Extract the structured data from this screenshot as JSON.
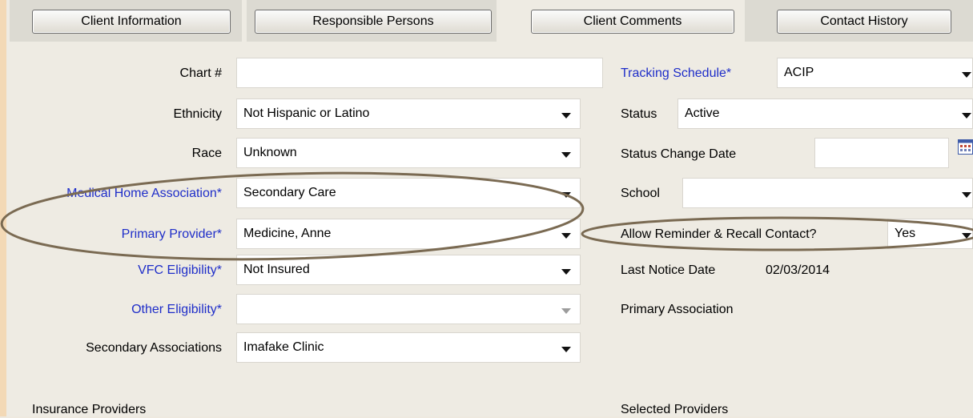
{
  "tabs": {
    "client_information": "Client Information",
    "responsible_persons": "Responsible Persons",
    "client_comments": "Client Comments",
    "contact_history": "Contact History"
  },
  "left": {
    "chart": {
      "label": "Chart #",
      "value": ""
    },
    "ethnicity": {
      "label": "Ethnicity",
      "value": "Not Hispanic or Latino"
    },
    "race": {
      "label": "Race",
      "value": "Unknown"
    },
    "medical_home": {
      "label": "Medical Home Association*",
      "value": "Secondary Care"
    },
    "primary_provider": {
      "label": "Primary Provider*",
      "value": "Medicine, Anne"
    },
    "vfc": {
      "label": "VFC Eligibility*",
      "value": "Not Insured"
    },
    "other_eligibility": {
      "label": "Other Eligibility*",
      "value": ""
    },
    "secondary_assoc": {
      "label": "Secondary Associations",
      "value": "Imafake Clinic"
    }
  },
  "right": {
    "tracking": {
      "label": "Tracking Schedule*",
      "value": "ACIP"
    },
    "status": {
      "label": "Status",
      "value": "Active"
    },
    "status_change": {
      "label": "Status Change Date",
      "value": ""
    },
    "school": {
      "label": "School",
      "value": ""
    },
    "reminder": {
      "label": "Allow Reminder & Recall Contact?",
      "value": "Yes"
    },
    "last_notice": {
      "label": "Last Notice Date",
      "value": "02/03/2014"
    },
    "primary_assoc": {
      "label": "Primary Association"
    }
  },
  "bottom": {
    "insurance_providers": "Insurance Providers",
    "selected_providers": "Selected Providers"
  },
  "colors": {
    "required_label": "#1f2ec9",
    "annotation": "#7a6a52",
    "parchment": "#f3d9b6"
  },
  "icons": {
    "calendar": "calendar-icon",
    "dropdown": "chevron-down-icon"
  }
}
